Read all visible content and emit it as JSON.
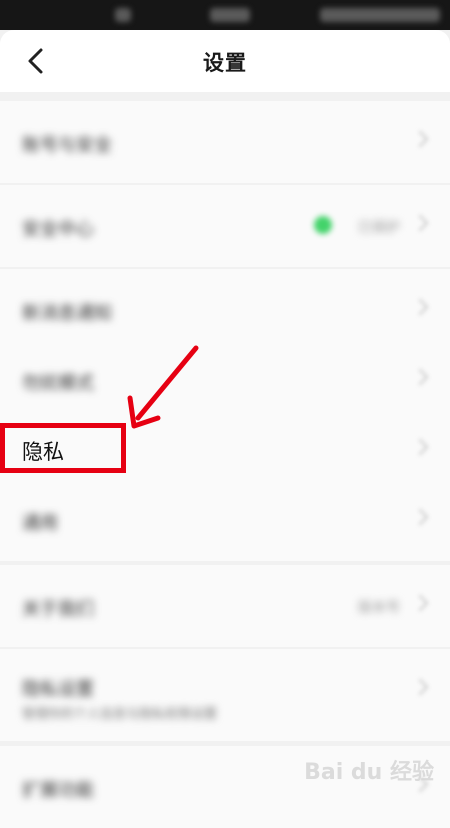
{
  "header": {
    "back_icon": "chevron-left-icon",
    "title": "设置"
  },
  "settings_rows": {
    "privacy_label": "隐私"
  },
  "annotation": {
    "highlight_color": "#e60012"
  },
  "watermark": {
    "text": "Bai du 经验"
  },
  "colors": {
    "status_bar": "#161616",
    "background": "#f1f1f1",
    "toggle_green": "#43d36a"
  }
}
